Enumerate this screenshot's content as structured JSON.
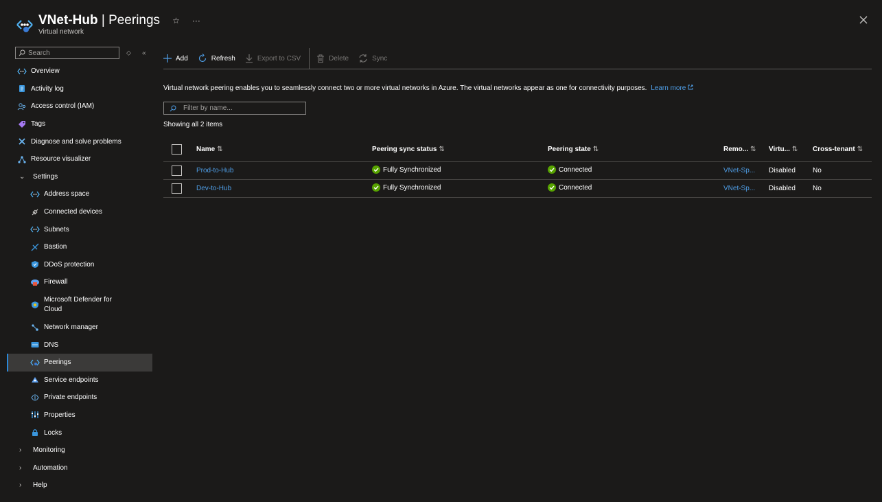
{
  "header": {
    "resource": "VNet-Hub",
    "separator": " | ",
    "blade": "Peerings",
    "subtitle": "Virtual network"
  },
  "sidebar": {
    "search_placeholder": "Search",
    "items": [
      {
        "label": "Overview",
        "icon": "vnet-icon"
      },
      {
        "label": "Activity log",
        "icon": "activity-log-icon"
      },
      {
        "label": "Access control (IAM)",
        "icon": "iam-icon"
      },
      {
        "label": "Tags",
        "icon": "tag-icon"
      },
      {
        "label": "Diagnose and solve problems",
        "icon": "wrench-icon"
      },
      {
        "label": "Resource visualizer",
        "icon": "visualizer-icon"
      },
      {
        "label": "Settings",
        "icon": "chevron-down-icon"
      },
      {
        "label": "Address space",
        "icon": "vnet-icon"
      },
      {
        "label": "Connected devices",
        "icon": "plug-icon"
      },
      {
        "label": "Subnets",
        "icon": "vnet-icon"
      },
      {
        "label": "Bastion",
        "icon": "bastion-icon"
      },
      {
        "label": "DDoS protection",
        "icon": "shield-icon"
      },
      {
        "label": "Firewall",
        "icon": "firewall-icon"
      },
      {
        "label": "Microsoft Defender for Cloud",
        "icon": "defender-icon"
      },
      {
        "label": "Network manager",
        "icon": "network-manager-icon"
      },
      {
        "label": "DNS",
        "icon": "dns-icon"
      },
      {
        "label": "Peerings",
        "icon": "peerings-icon"
      },
      {
        "label": "Service endpoints",
        "icon": "service-endpoints-icon"
      },
      {
        "label": "Private endpoints",
        "icon": "private-endpoints-icon"
      },
      {
        "label": "Properties",
        "icon": "properties-icon"
      },
      {
        "label": "Locks",
        "icon": "lock-icon"
      },
      {
        "label": "Monitoring",
        "icon": "chevron-right-icon"
      },
      {
        "label": "Automation",
        "icon": "chevron-right-icon"
      },
      {
        "label": "Help",
        "icon": "chevron-right-icon"
      }
    ]
  },
  "toolbar": {
    "add": "Add",
    "refresh": "Refresh",
    "export": "Export to CSV",
    "delete": "Delete",
    "sync": "Sync"
  },
  "info": {
    "text": "Virtual network peering enables you to seamlessly connect two or more virtual networks in Azure. The virtual networks appear as one for connectivity purposes.",
    "link": "Learn more"
  },
  "filter_placeholder": "Filter by name...",
  "count_text": "Showing all 2 items",
  "table": {
    "columns": [
      "Name",
      "Peering sync status",
      "Peering state",
      "Remo...",
      "Virtu...",
      "Cross-tenant"
    ],
    "rows": [
      {
        "name": "Prod-to-Hub",
        "sync": "Fully Synchronized",
        "state": "Connected",
        "remote": "VNet-Sp...",
        "virtual": "Disabled",
        "cross": "No"
      },
      {
        "name": "Dev-to-Hub",
        "sync": "Fully Synchronized",
        "state": "Connected",
        "remote": "VNet-Sp...",
        "virtual": "Disabled",
        "cross": "No"
      }
    ]
  },
  "colors": {
    "background": "#1b1a19",
    "accent": "#2b88d8",
    "link": "#4f9fe8",
    "success": "#57a300"
  }
}
